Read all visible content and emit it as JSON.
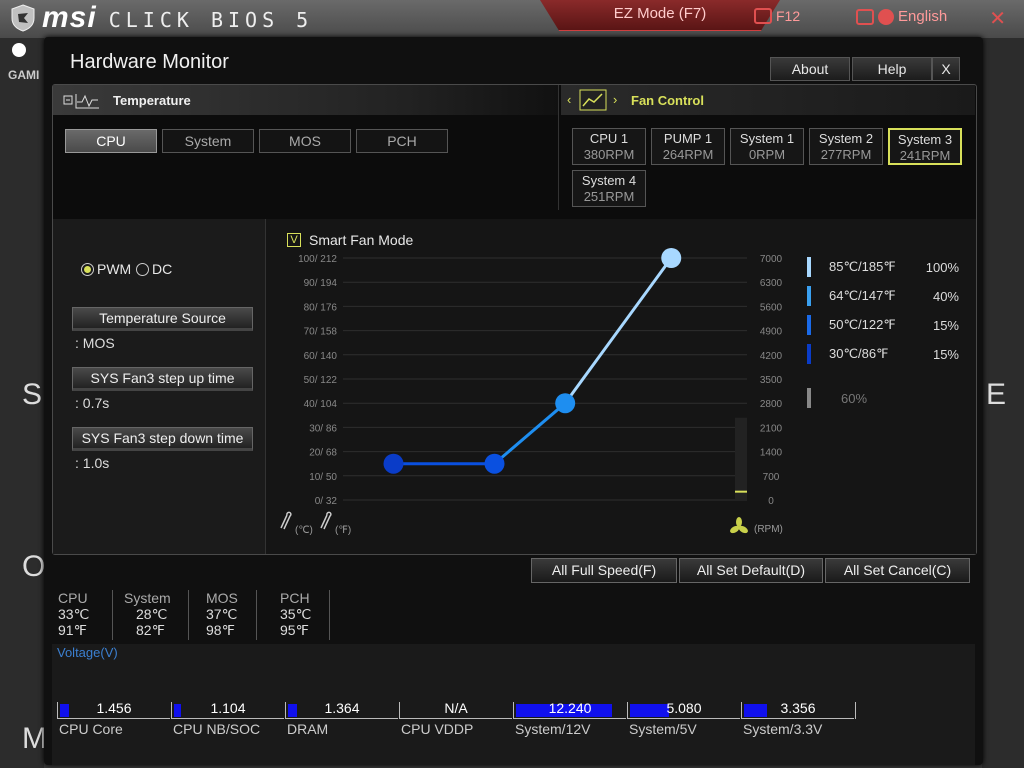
{
  "bios": {
    "brand": "msi",
    "product": "CLICK BIOS 5",
    "ez_mode": "EZ Mode (F7)",
    "screenshot_key": "F12",
    "language": "English",
    "close": "✕",
    "bg_gam": "GAMI"
  },
  "window": {
    "title": "Hardware Monitor",
    "about": "About",
    "help": "Help",
    "close": "X"
  },
  "temperature": {
    "header": "Temperature",
    "tabs": [
      "CPU",
      "System",
      "MOS",
      "PCH"
    ],
    "active_tab": "CPU"
  },
  "fan_control": {
    "header": "Fan Control",
    "fans": [
      {
        "name": "CPU 1",
        "rpm": "380RPM"
      },
      {
        "name": "PUMP 1",
        "rpm": "264RPM"
      },
      {
        "name": "System 1",
        "rpm": "0RPM"
      },
      {
        "name": "System 2",
        "rpm": "277RPM"
      },
      {
        "name": "System 3",
        "rpm": "241RPM"
      },
      {
        "name": "System 4",
        "rpm": "251RPM"
      }
    ],
    "active_fan": "System 3"
  },
  "settings": {
    "pwm": "PWM",
    "dc": "DC",
    "mode_selected": "PWM",
    "temp_source_label": "Temperature Source",
    "temp_source_value": ": MOS",
    "step_up_label": "SYS Fan3 step up time",
    "step_up_value": ": 0.7s",
    "step_down_label": "SYS Fan3 step down time",
    "step_down_value": ": 1.0s"
  },
  "smart_fan": {
    "label": "Smart Fan Mode",
    "checked": true,
    "check_glyph": "V"
  },
  "chart_data": {
    "type": "line",
    "y_left_ticks": [
      "100/ 212",
      "90/ 194",
      "80/ 176",
      "70/ 158",
      "60/ 140",
      "50/ 122",
      "40/ 104",
      "30/  86",
      "20/  68",
      "10/  50",
      "0/  32"
    ],
    "y_right_ticks": [
      "7000",
      "6300",
      "5600",
      "4900",
      "4200",
      "3500",
      "2800",
      "2100",
      "1400",
      "700",
      "0"
    ],
    "celsius_label": "(℃)",
    "fahrenheit_label": "(℉)",
    "rpm_label": "(RPM)",
    "points": [
      {
        "temp_c": 30,
        "speed_pct": 15
      },
      {
        "temp_c": 50,
        "speed_pct": 15
      },
      {
        "temp_c": 64,
        "speed_pct": 40
      },
      {
        "temp_c": 85,
        "speed_pct": 100
      }
    ],
    "point_colors": [
      "#0a3cc8",
      "#0a50e0",
      "#1e8ef0",
      "#a8d8ff"
    ],
    "current_rpm": 241,
    "xlim": [
      20,
      100
    ],
    "ylim": [
      0,
      100
    ]
  },
  "legend": [
    {
      "temp": "85℃/185℉",
      "pct": "100%",
      "color": "#a8d8ff"
    },
    {
      "temp": "64℃/147℉",
      "pct": "40%",
      "color": "#3aa0f0"
    },
    {
      "temp": "50℃/122℉",
      "pct": "15%",
      "color": "#1a6ae8"
    },
    {
      "temp": "30℃/86℉",
      "pct": "15%",
      "color": "#0a3cc8"
    },
    {
      "temp": "",
      "pct": "60%",
      "color": "#888888"
    }
  ],
  "actions": {
    "full_speed": "All Full Speed(F)",
    "set_default": "All Set Default(D)",
    "set_cancel": "All Set Cancel(C)"
  },
  "temps": [
    {
      "name": "CPU",
      "c": "33℃",
      "f": "91℉"
    },
    {
      "name": "System",
      "c": "28℃",
      "f": "82℉"
    },
    {
      "name": "MOS",
      "c": "37℃",
      "f": "98℉"
    },
    {
      "name": "PCH",
      "c": "35℃",
      "f": "95℉"
    }
  ],
  "voltage": {
    "title": "Voltage(V)",
    "items": [
      {
        "name": "CPU Core",
        "value": "1.456",
        "fill": 0.08
      },
      {
        "name": "CPU NB/SOC",
        "value": "1.104",
        "fill": 0.06
      },
      {
        "name": "DRAM",
        "value": "1.364",
        "fill": 0.08
      },
      {
        "name": "CPU VDDP",
        "value": "N/A",
        "fill": 0
      },
      {
        "name": "System/12V",
        "value": "12.240",
        "fill": 0.88
      },
      {
        "name": "System/5V",
        "value": "5.080",
        "fill": 0.36
      },
      {
        "name": "System/3.3V",
        "value": "3.356",
        "fill": 0.21
      }
    ]
  }
}
